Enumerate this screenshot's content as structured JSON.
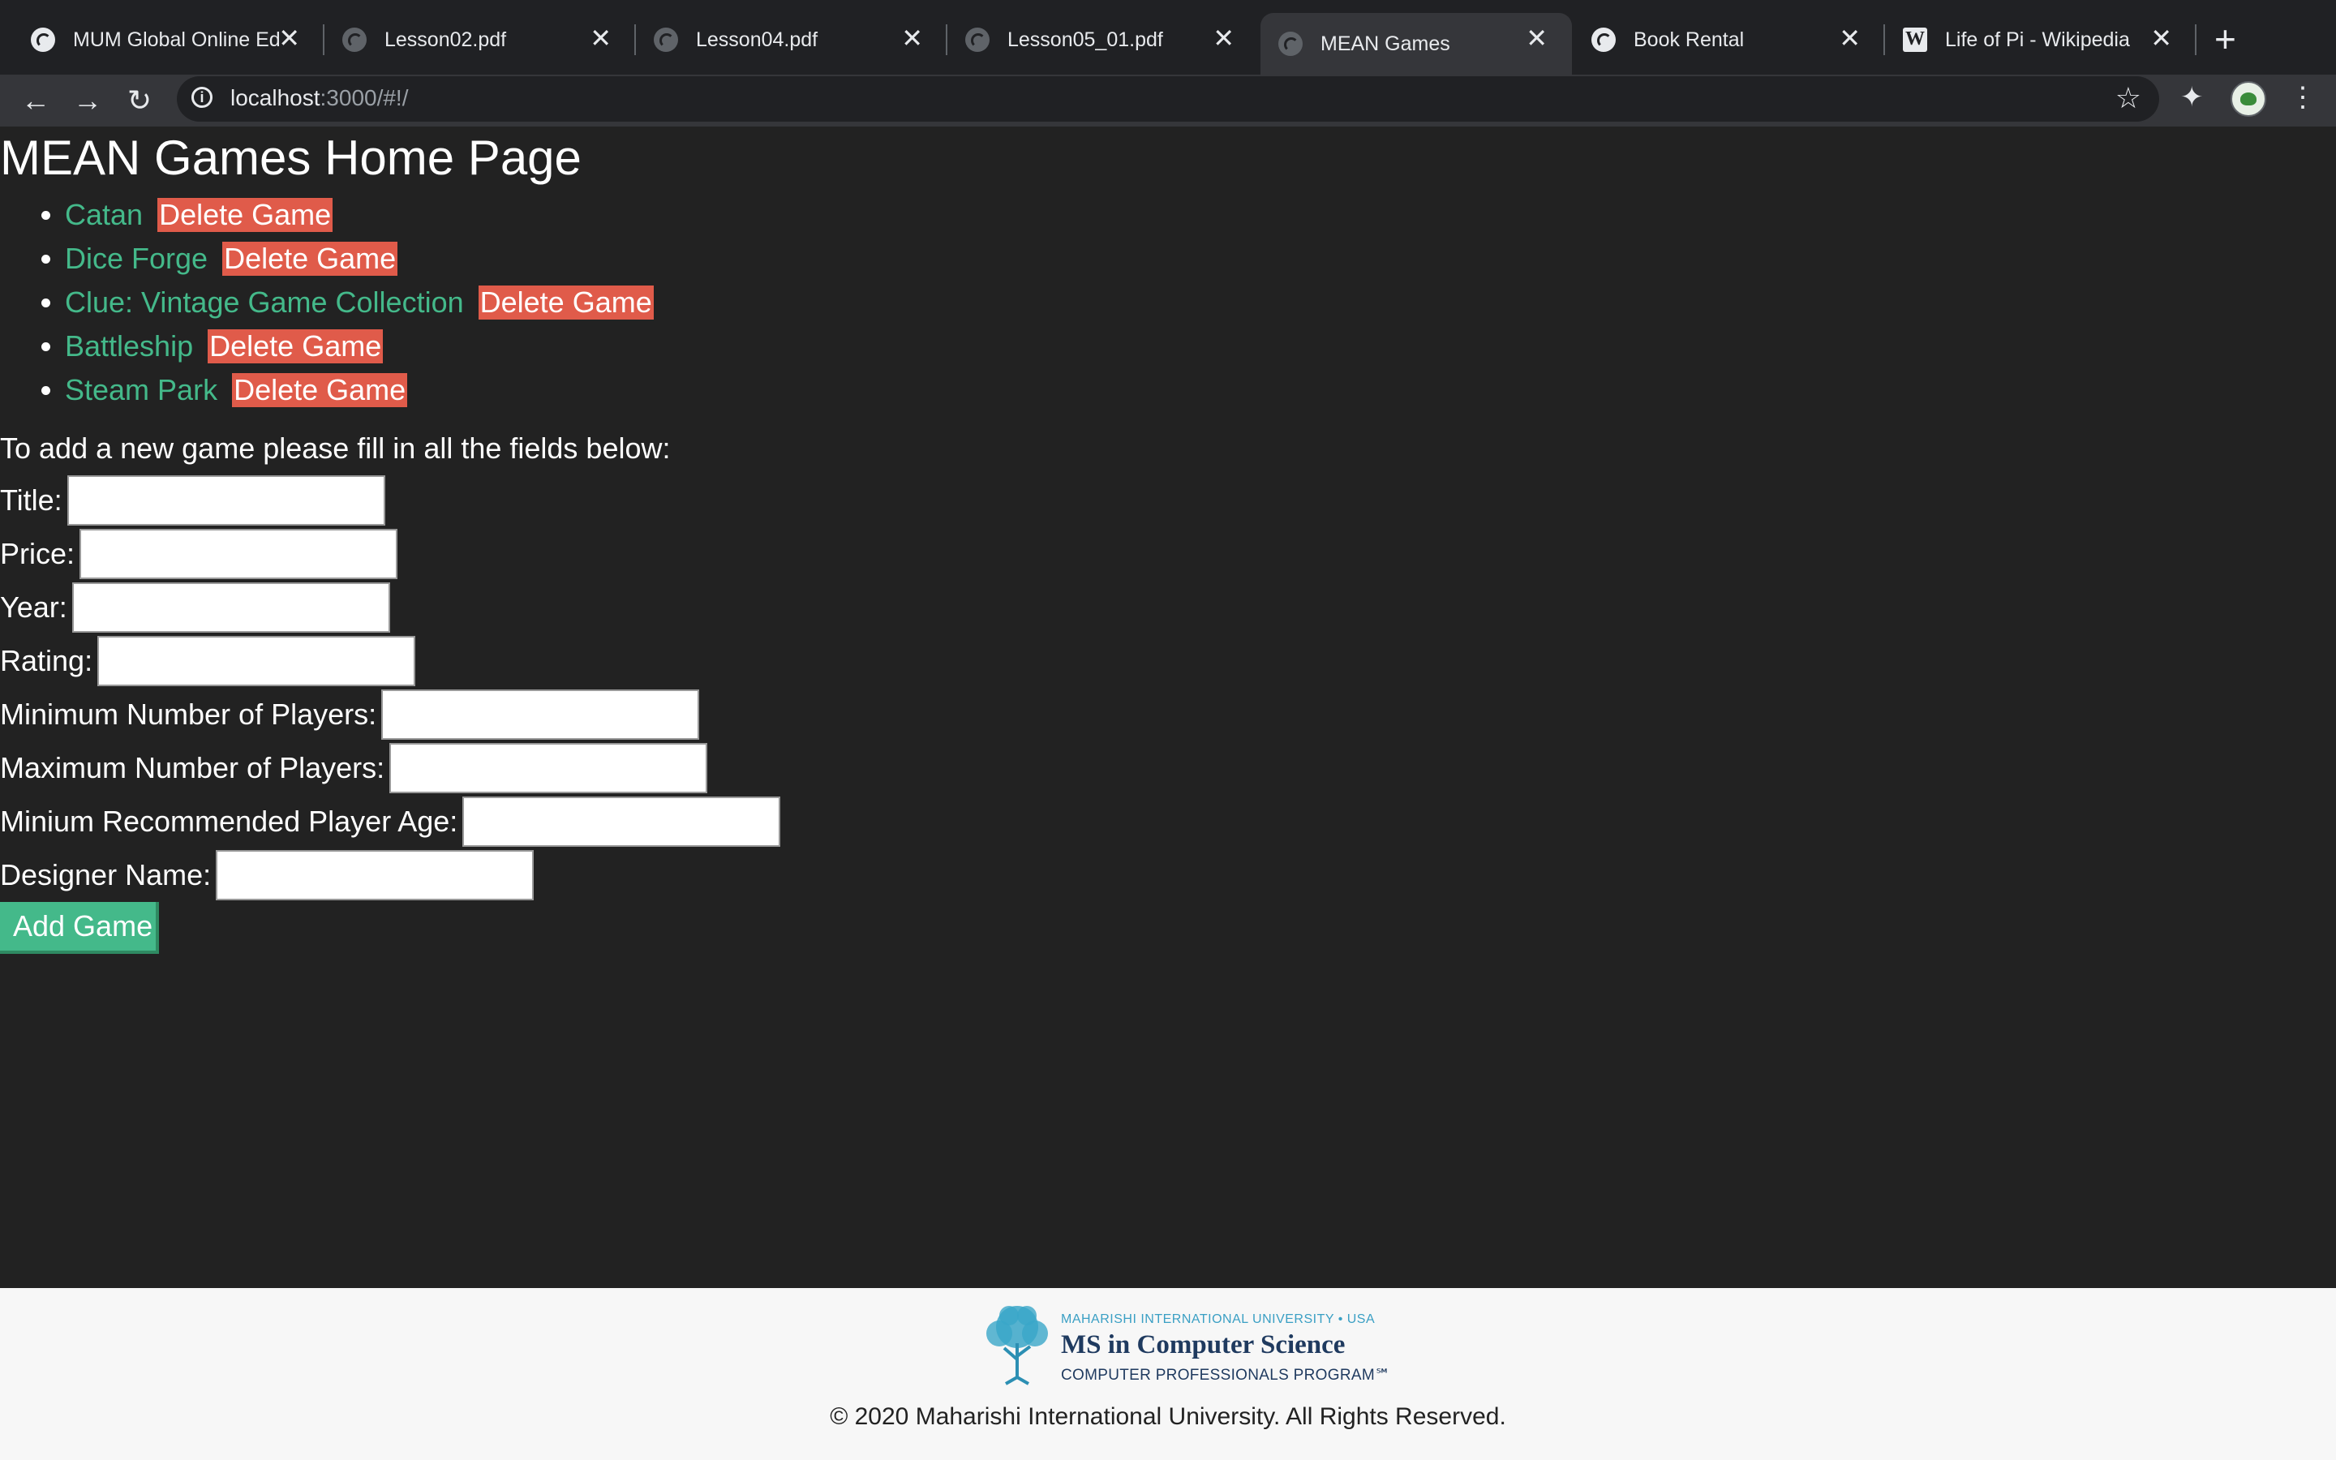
{
  "browser": {
    "tabs": [
      {
        "title": "MUM Global Online Ed",
        "icon": "globe-icon",
        "active": false
      },
      {
        "title": "Lesson02.pdf",
        "icon": "globe-icon",
        "active": false
      },
      {
        "title": "Lesson04.pdf",
        "icon": "globe-icon",
        "active": false
      },
      {
        "title": "Lesson05_01.pdf",
        "icon": "globe-icon",
        "active": false
      },
      {
        "title": "MEAN Games",
        "icon": "globe-icon",
        "active": true
      },
      {
        "title": "Book Rental",
        "icon": "globe-icon",
        "active": false
      },
      {
        "title": "Life of Pi - Wikipedia",
        "icon": "wikipedia-icon",
        "active": false
      }
    ],
    "close_glyph": "✕",
    "new_tab_glyph": "+",
    "url_host": "localhost",
    "url_rest": ":3000/#!/"
  },
  "page": {
    "title": "MEAN Games Home Page",
    "games": [
      {
        "name": "Catan",
        "delete_label": "Delete Game"
      },
      {
        "name": "Dice Forge",
        "delete_label": "Delete Game"
      },
      {
        "name": "Clue: Vintage Game Collection",
        "delete_label": "Delete Game"
      },
      {
        "name": "Battleship",
        "delete_label": "Delete Game"
      },
      {
        "name": "Steam Park",
        "delete_label": "Delete Game"
      }
    ],
    "form_intro": "To add a new game please fill in all the fields below:",
    "fields": {
      "title": {
        "label": "Title:",
        "value": ""
      },
      "price": {
        "label": "Price:",
        "value": ""
      },
      "year": {
        "label": "Year:",
        "value": ""
      },
      "rating": {
        "label": "Rating:",
        "value": ""
      },
      "min_players": {
        "label": "Minimum Number of Players:",
        "value": ""
      },
      "max_players": {
        "label": "Maximum Number of Players: ",
        "value": ""
      },
      "min_age": {
        "label": "Minium Recommended Player Age:",
        "value": ""
      },
      "designer": {
        "label": "Designer Name:",
        "value": ""
      }
    },
    "add_button_label": "Add Game"
  },
  "footer": {
    "logo_top": "MAHARISHI INTERNATIONAL UNIVERSITY • USA",
    "logo_main": "MS in Computer Science",
    "logo_bottom": "COMPUTER PROFESSIONALS PROGRAM℠",
    "copyright": "© 2020 Maharishi International University. All Rights Reserved."
  },
  "colors": {
    "page_bg": "#222222",
    "link_green": "#44b98a",
    "delete_red": "#e05b4a"
  }
}
